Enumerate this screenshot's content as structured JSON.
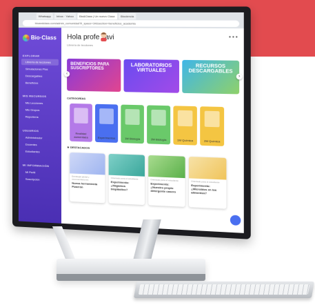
{
  "colors": {
    "brand_red": "#e24b4f",
    "sidebar": "#5a37c6",
    "accent_blue": "#4a6ff0"
  },
  "browser": {
    "tabs": [
      "Whatsapp",
      "Inbox · Yahoo",
      "Bio&Class | Un nuevo Clase",
      "Biociencia"
    ],
    "url": "bioandclass.com/admin_comunidad?ll_space=1#&section=beneficios_academia"
  },
  "sidebar": {
    "logo": "Bio·Class",
    "sections": [
      {
        "title": "EXPLORAR",
        "items": [
          "Librería de lecciones",
          "Simulaciones Plus",
          "Descargables",
          "Beneficios"
        ]
      },
      {
        "title": "MIS RECURSOS",
        "items": [
          "Mis Lecciones",
          "Mis Grupos",
          "Reportería"
        ]
      },
      {
        "title": "USUARIOS",
        "items": [
          "Administrador",
          "Docentes",
          "Estudiantes"
        ]
      },
      {
        "title": "MI INFORMACIÓN",
        "items": [
          "Mi Perfil",
          "Suscripción"
        ]
      }
    ]
  },
  "main": {
    "greeting": "Hola profe Javi",
    "subtitle": "Librería de lecciones",
    "banners": [
      "BENEFICIOS PARA SUSCRIPTORES",
      "LABORATORIOS VIRTUALES",
      "RECURSOS DESCARGABLES"
    ],
    "categories_title": "CATEGORÍAS",
    "categories": [
      {
        "label": "Realidad aumentada",
        "color": "#b47ae8"
      },
      {
        "label": "Experimentos",
        "color": "#4a6ff0"
      },
      {
        "label": "1M Biología",
        "color": "#6ac96a"
      },
      {
        "label": "2M Biología",
        "color": "#6ac96a"
      },
      {
        "label": "1M Química",
        "color": "#f4c542"
      },
      {
        "label": "2M Química",
        "color": "#f4c542"
      }
    ],
    "featured_title": "DESTACADOS",
    "featured": [
      {
        "meta": "Estrategia global y recomendaciones",
        "title": "Nueva herramienta Pizarrón"
      },
      {
        "meta": "Orientado para el estudiante",
        "title": "Experimento: ¿Hagamos bioplástico?"
      },
      {
        "meta": "Orientado para el estudiante",
        "title": "Experimento: ¿Nuestro propio detergente casero"
      },
      {
        "meta": "Orientado para el estudiante",
        "title": "Experimento: ¿Microbios en los alimentos?"
      }
    ]
  }
}
